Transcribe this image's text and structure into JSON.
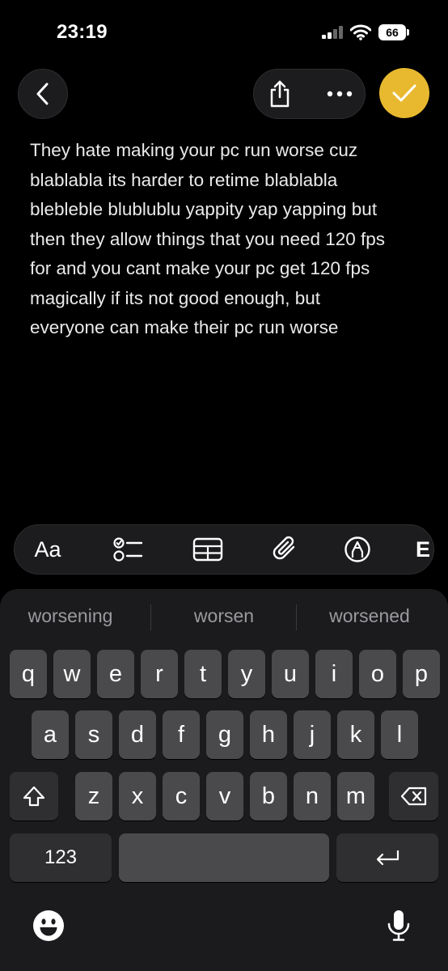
{
  "status_bar": {
    "time": "23:19",
    "battery": "66"
  },
  "note": {
    "lines": [
      "They hate making your pc run worse cuz",
      "blablabla its harder to retime blablabla",
      "blebleble blublublu yappity yap yapping but",
      "then they allow things that you need 120 fps",
      "for and you cant make your pc get 120 fps",
      "magically if its not good enough, but",
      "everyone can make their pc run worse"
    ]
  },
  "toolbar": {
    "format_label": "Aa",
    "icons": [
      "checklist-icon",
      "table-icon",
      "paperclip-icon",
      "markup-pen-icon",
      "more-tools-icon"
    ],
    "partial_label": "E"
  },
  "keyboard": {
    "suggestions": [
      "worsening",
      "worsen",
      "worsened"
    ],
    "row1": [
      "q",
      "w",
      "e",
      "r",
      "t",
      "y",
      "u",
      "i",
      "o",
      "p"
    ],
    "row2": [
      "a",
      "s",
      "d",
      "f",
      "g",
      "h",
      "j",
      "k",
      "l"
    ],
    "row3": [
      "z",
      "x",
      "c",
      "v",
      "b",
      "n",
      "m"
    ],
    "numbers_label": "123"
  },
  "colors": {
    "accent": "#e8b92f",
    "background": "#000000",
    "keyboard": "#1b1b1d",
    "key": "#4a4a4c"
  }
}
